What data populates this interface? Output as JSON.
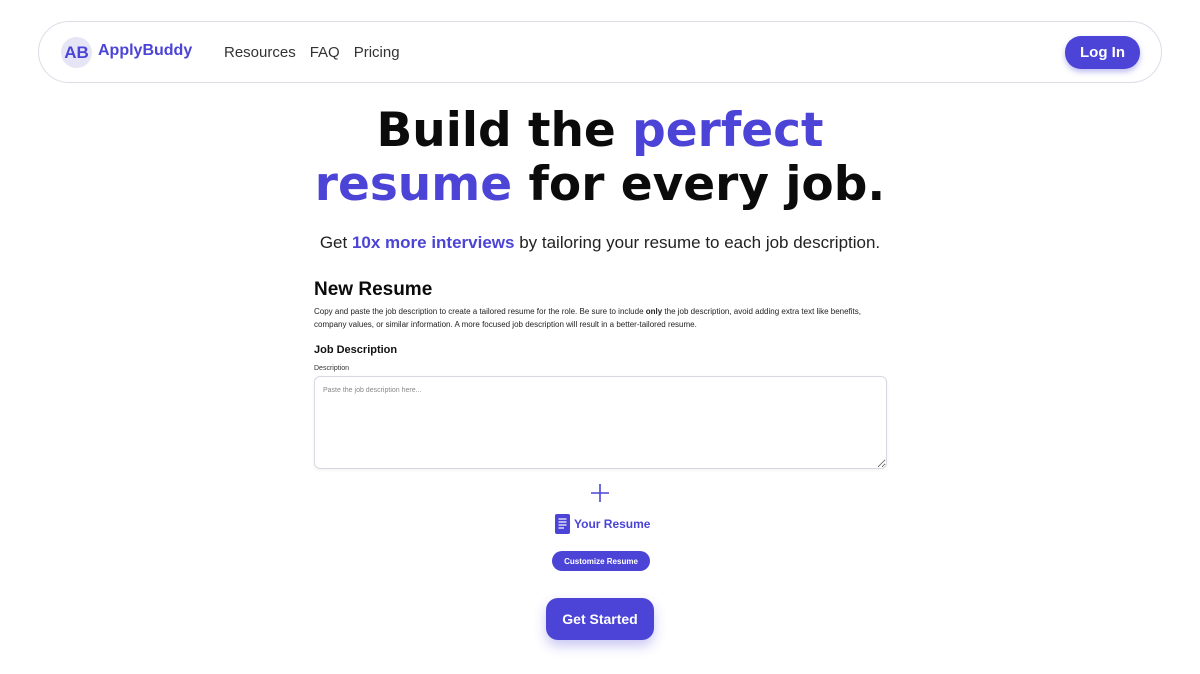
{
  "colors": {
    "accent": "#4b44d6",
    "text": "#0b0b0b",
    "badge_bg": "#e6e5f5"
  },
  "nav": {
    "logo_initials": "AB",
    "brand": "ApplyBuddy",
    "links": [
      "Resources",
      "FAQ",
      "Pricing"
    ],
    "login_label": "Log In"
  },
  "hero": {
    "line1_part1": "Build the ",
    "line1_accent": "perfect",
    "line2_accent": "resume",
    "line2_part2": " for every job.",
    "subtitle_part1": "Get ",
    "subtitle_highlight": "10x more interviews",
    "subtitle_part2": " by tailoring your resume to each job description."
  },
  "form": {
    "title": "New Resume",
    "desc_part1": "Copy and paste the job description to create a tailored resume for the role. Be sure to include ",
    "desc_bold": "only",
    "desc_part2": " the job description, avoid adding extra text like benefits, company values, or similar information. A more focused job description will result in a better-tailored resume.",
    "section_title": "Job Description",
    "field_label": "Description",
    "placeholder": "Paste the job description here...",
    "value": ""
  },
  "resume": {
    "plus_icon": "plus-icon",
    "doc_icon": "document-icon",
    "label": "Your Resume",
    "customize_label": "Customize Resume"
  },
  "cta": {
    "label": "Get Started"
  }
}
